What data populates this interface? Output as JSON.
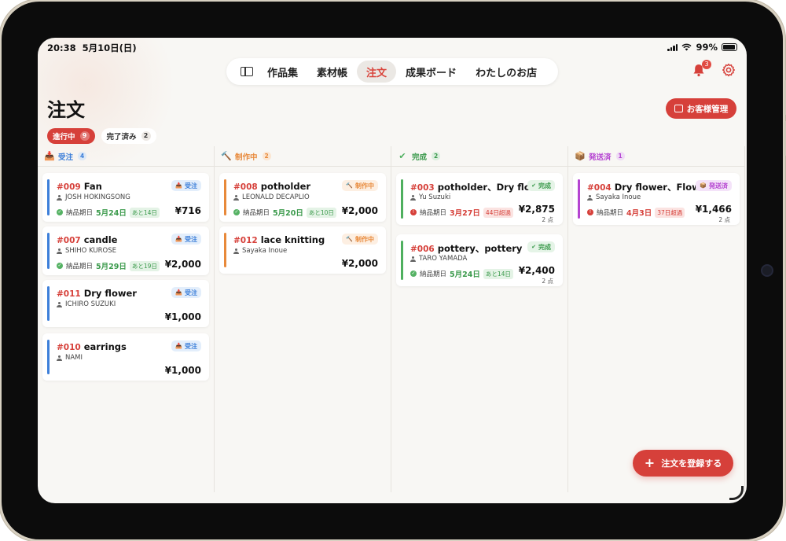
{
  "status_bar": {
    "time": "20:38",
    "date": "5月10日(日)",
    "battery": "99%"
  },
  "nav": {
    "items": [
      {
        "label": "作品集"
      },
      {
        "label": "素材帳"
      },
      {
        "label": "注文",
        "active": true
      },
      {
        "label": "成果ボード"
      },
      {
        "label": "わたしのお店"
      }
    ]
  },
  "header": {
    "notification_count": "3",
    "customer_button": "お客様管理"
  },
  "page_title": "注文",
  "filters": [
    {
      "label": "進行中",
      "count": "9",
      "active": true
    },
    {
      "label": "完了済み",
      "count": "2",
      "active": false
    }
  ],
  "columns": [
    {
      "label": "受注",
      "count": "4",
      "color": "#3d7fd9",
      "icon": "inbox-icon",
      "cards": [
        {
          "number": "#009",
          "title": "Fan",
          "customer": "JOSH HOKINGSONG",
          "status": "受注",
          "due_label": "納品期日",
          "due_date": "5月24日",
          "due_tag": "あと14日",
          "due_state": "green",
          "price": "¥716",
          "qty": ""
        },
        {
          "number": "#007",
          "title": "candle",
          "customer": "SHIHO KUROSE",
          "status": "受注",
          "due_label": "納品期日",
          "due_date": "5月29日",
          "due_tag": "あと19日",
          "due_state": "green",
          "price": "¥2,000",
          "qty": ""
        },
        {
          "number": "#011",
          "title": "Dry flower",
          "customer": "ICHIRO SUZUKI",
          "status": "受注",
          "price": "¥1,000",
          "qty": ""
        },
        {
          "number": "#010",
          "title": "earrings",
          "customer": "NAMI",
          "status": "受注",
          "price": "¥1,000",
          "qty": ""
        }
      ]
    },
    {
      "label": "制作中",
      "count": "2",
      "color": "#e8893a",
      "icon": "hammer-icon",
      "cards": [
        {
          "number": "#008",
          "title": "potholder",
          "customer": "LEONALD DECAPLIO",
          "status": "制作中",
          "due_label": "納品期日",
          "due_date": "5月20日",
          "due_tag": "あと10日",
          "due_state": "green",
          "price": "¥2,000",
          "qty": ""
        },
        {
          "number": "#012",
          "title": "lace knitting",
          "customer": "Sayaka Inoue",
          "status": "制作中",
          "price": "¥2,000",
          "qty": ""
        }
      ]
    },
    {
      "label": "完成",
      "count": "2",
      "color": "#4fb05f",
      "icon": "check-circle-icon",
      "cards": [
        {
          "number": "#003",
          "title": "potholder、Dry flo...",
          "customer": "Yu Suzuki",
          "status": "完成",
          "due_label": "納品期日",
          "due_date": "3月27日",
          "due_tag": "44日超過",
          "due_state": "red",
          "price": "¥2,875",
          "qty": "2 点"
        },
        {
          "number": "#006",
          "title": "pottery、pottery",
          "customer": "TARO YAMADA",
          "status": "完成",
          "due_label": "納品期日",
          "due_date": "5月24日",
          "due_tag": "あと14日",
          "due_state": "green",
          "price": "¥2,400",
          "qty": "2 点"
        }
      ]
    },
    {
      "label": "発送済",
      "count": "1",
      "color": "#b544d1",
      "icon": "package-icon",
      "cards": [
        {
          "number": "#004",
          "title": "Dry flower、Flower",
          "customer": "Sayaka Inoue",
          "status": "発送済",
          "due_label": "納品期日",
          "due_date": "4月3日",
          "due_tag": "37日超過",
          "due_state": "red",
          "price": "¥1,466",
          "qty": "2 点"
        }
      ]
    }
  ],
  "fab_label": "注文を登録する"
}
